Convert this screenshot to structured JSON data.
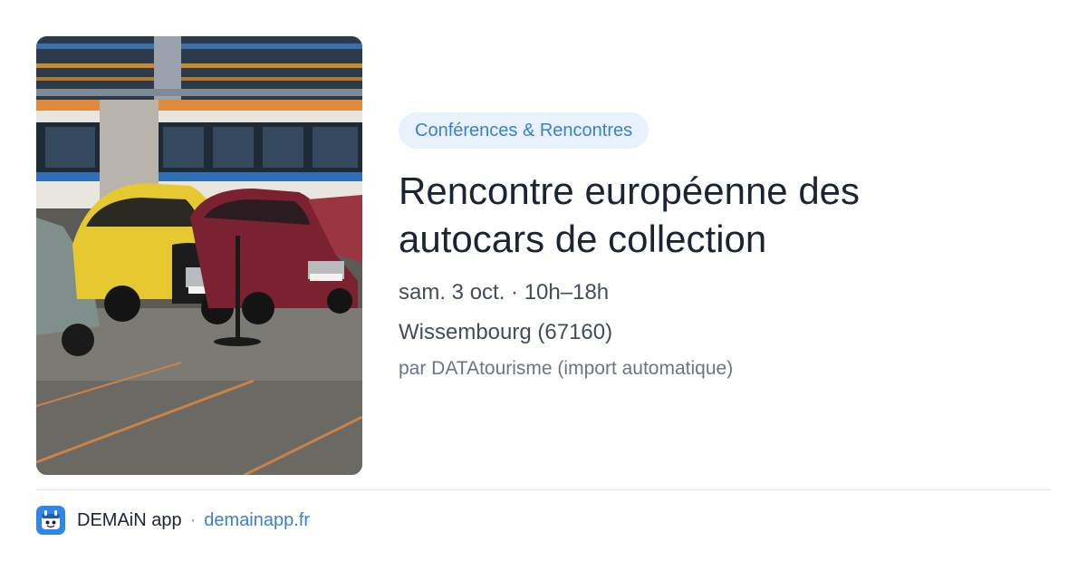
{
  "event": {
    "category": "Conférences & Rencontres",
    "title_line1": "Rencontre européenne des",
    "title_line2": "autocars de collection",
    "when": "sam. 3 oct. · 10h–18h",
    "where": "Wissembourg (67160)",
    "source": "par DATAtourisme (import automatique)",
    "image": "vintage-cars-in-bus-depot-photo"
  },
  "footer": {
    "app_icon": "demain-app-icon",
    "app_name": "DEMAiN app",
    "separator": "·",
    "url": "demainapp.fr"
  },
  "colors": {
    "accent": "#3b7fd0",
    "pill_bg": "#e8f1fc",
    "title": "#1c2433",
    "body": "#424c5c",
    "muted": "#6b7585"
  }
}
